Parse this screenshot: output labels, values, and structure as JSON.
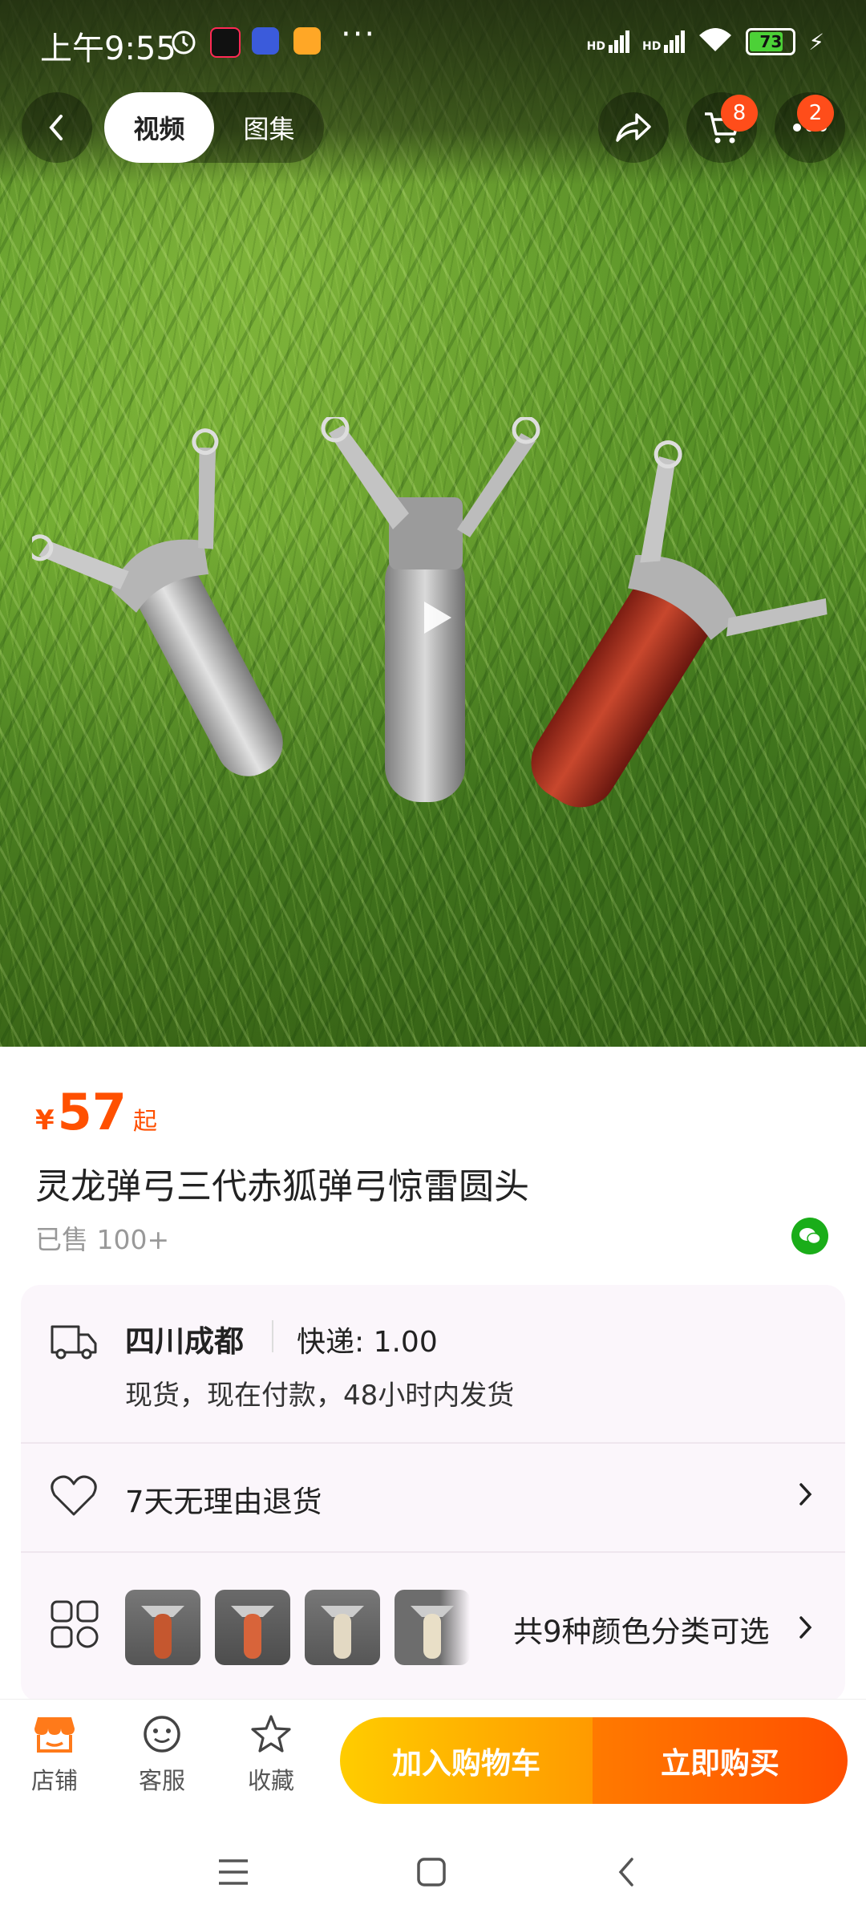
{
  "status_bar": {
    "time": "上午9:55",
    "more": "···",
    "signal1": "HD",
    "signal2": "HD",
    "battery": "73"
  },
  "top_nav": {
    "tabs": [
      {
        "label": "视频",
        "active": true
      },
      {
        "label": "图集",
        "active": false
      }
    ],
    "cart_badge": "8",
    "more_badge": "2"
  },
  "media": {
    "icon": "play-icon"
  },
  "product": {
    "currency": "¥",
    "price": "57",
    "price_suffix": "起",
    "title": "灵龙弹弓三代赤狐弹弓惊雷圆头",
    "sold": "已售 100+"
  },
  "shipping": {
    "location": "四川成都",
    "fee": "快递: 1.00",
    "note": "现货，现在付款，48小时内发货"
  },
  "returns": {
    "label": "7天无理由退货"
  },
  "variants": {
    "summary": "共9种颜色分类可选"
  },
  "bottom_bar": {
    "store": "店铺",
    "service": "客服",
    "favorite": "收藏",
    "add_to_cart": "加入购物车",
    "buy_now": "立即购买"
  },
  "colors": {
    "accent": "#ff5000",
    "cart_gradient_start": "#ffcc00",
    "buy_gradient_end": "#ff4f00"
  }
}
